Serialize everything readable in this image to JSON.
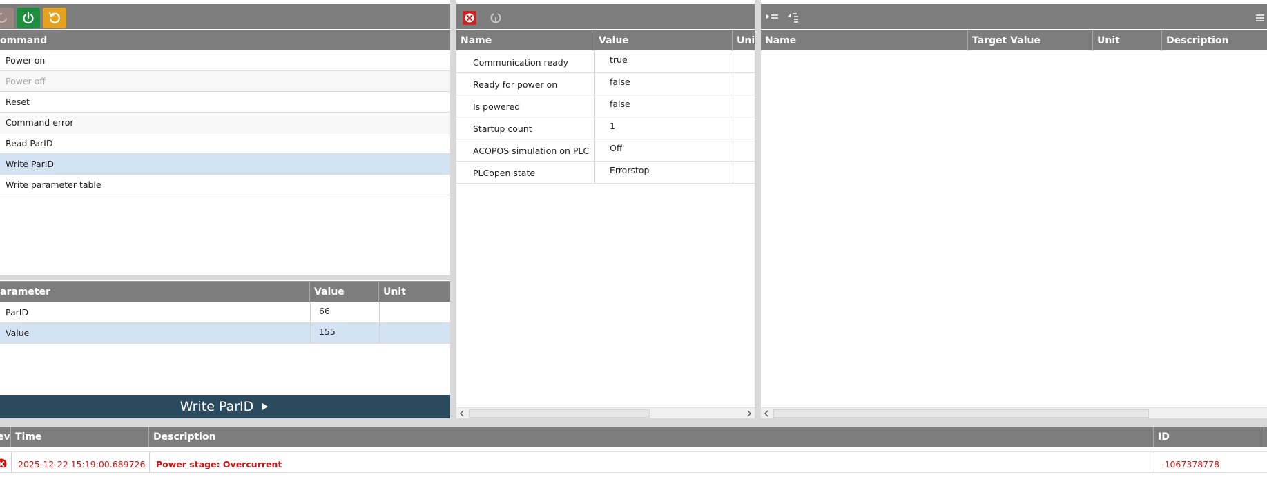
{
  "left_panel": {
    "commands": {
      "header": "ommand",
      "items": [
        {
          "label": "Power on",
          "disabled": false,
          "selected": false
        },
        {
          "label": "Power off",
          "disabled": true,
          "selected": false
        },
        {
          "label": "Reset",
          "disabled": false,
          "selected": false
        },
        {
          "label": "Command error",
          "disabled": false,
          "selected": false
        },
        {
          "label": "Read ParID",
          "disabled": false,
          "selected": false
        },
        {
          "label": "Write ParID",
          "disabled": false,
          "selected": true
        },
        {
          "label": "Write parameter table",
          "disabled": false,
          "selected": false
        }
      ]
    },
    "parameters": {
      "headers": {
        "parameter": "arameter",
        "value": "Value",
        "unit": "Unit"
      },
      "rows": [
        {
          "name": "ParID",
          "value": "66",
          "unit": ""
        },
        {
          "name": "Value",
          "value": "155",
          "unit": ""
        }
      ]
    },
    "action_button": {
      "label": "Write ParID"
    }
  },
  "middle_panel": {
    "headers": {
      "name": "Name",
      "value": "Value",
      "unit": "Unit"
    },
    "rows": [
      {
        "name": "Communication ready",
        "value": "true"
      },
      {
        "name": "Ready for power on",
        "value": "false"
      },
      {
        "name": "Is powered",
        "value": "false"
      },
      {
        "name": "Startup count",
        "value": "1"
      },
      {
        "name": "ACOPOS simulation on PLC",
        "value": "Off"
      },
      {
        "name": "PLCopen state",
        "value": "Errorstop"
      }
    ]
  },
  "right_panel": {
    "headers": {
      "name": "Name",
      "target_value": "Target Value",
      "unit": "Unit",
      "description": "Description"
    }
  },
  "log_panel": {
    "headers": {
      "level": "eve",
      "time": "Time",
      "description": "Description",
      "id": "ID"
    },
    "rows": [
      {
        "time": "2025-12-22 15:19:00.689726",
        "description": "Power stage: Overcurrent",
        "id": "-1067378778"
      }
    ]
  },
  "icons": {
    "power_on": "power-icon",
    "reset": "reset-icon",
    "error_clear": "error-clear-icon",
    "refresh": "refresh-icon",
    "expand_all": "expand-all-icon",
    "collapse_all": "collapse-all-icon",
    "menu": "menu-icon",
    "error": "error-icon"
  },
  "colors": {
    "header_bg": "#7d7d7d",
    "selected_row": "#d4e3f3",
    "action_button_bg": "#2b4a5e",
    "power_button": "#1e8e3e",
    "reset_button": "#e5a21f",
    "error_red": "#d01414"
  }
}
